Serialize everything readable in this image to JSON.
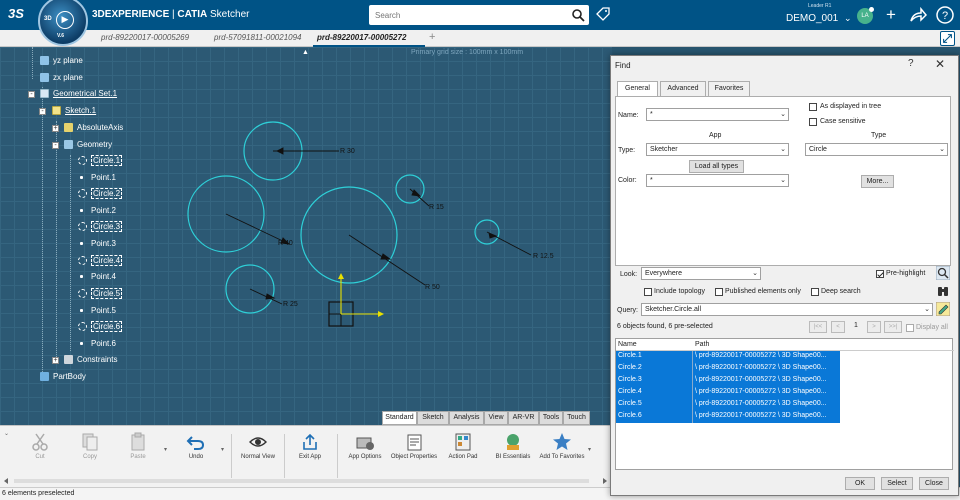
{
  "topbar": {
    "brand": "3DEXPERIENCE",
    "separator": " | ",
    "app": "CATIA",
    "app_suffix": " Sketcher",
    "compass_3d": "3D",
    "compass_version": "V.6",
    "search_placeholder": "Search",
    "user_role": "Leader R1",
    "user_name": "DEMO_001",
    "avatar_initials": "LA",
    "colors": {
      "bar": "#005386",
      "compass": "#1e5f91"
    }
  },
  "doc_tabs": [
    {
      "label": "prd-89220017-00005269",
      "active": false
    },
    {
      "label": "prd-57091811-00021094",
      "active": false
    },
    {
      "label": "prd-89220017-00005272",
      "active": true
    }
  ],
  "tree": [
    {
      "label": "yz plane",
      "icon": "plane-icon",
      "style": "plain"
    },
    {
      "label": "zx plane",
      "icon": "plane-icon",
      "style": "plain"
    },
    {
      "label": "Geometrical Set.1",
      "icon": "geometrical-set-icon",
      "style": "underline"
    },
    {
      "label": "Sketch.1",
      "icon": "sketch-icon",
      "style": "underline"
    },
    {
      "label": "AbsoluteAxis",
      "icon": "axis-icon",
      "style": "plain"
    },
    {
      "label": "Geometry",
      "icon": "geometry-icon",
      "style": "plain"
    },
    {
      "label": "Circle.1",
      "icon": "circle-icon",
      "style": "highlight"
    },
    {
      "label": "Point.1",
      "icon": "point-icon",
      "style": "plain"
    },
    {
      "label": "Circle.2",
      "icon": "circle-icon",
      "style": "highlight"
    },
    {
      "label": "Point.2",
      "icon": "point-icon",
      "style": "plain"
    },
    {
      "label": "Circle.3",
      "icon": "circle-icon",
      "style": "highlight"
    },
    {
      "label": "Point.3",
      "icon": "point-icon",
      "style": "plain"
    },
    {
      "label": "Circle.4",
      "icon": "circle-icon",
      "style": "highlight"
    },
    {
      "label": "Point.4",
      "icon": "point-icon",
      "style": "plain"
    },
    {
      "label": "Circle.5",
      "icon": "circle-icon",
      "style": "highlight"
    },
    {
      "label": "Point.5",
      "icon": "point-icon",
      "style": "plain"
    },
    {
      "label": "Circle.6",
      "icon": "circle-icon",
      "style": "highlight"
    },
    {
      "label": "Point.6",
      "icon": "point-icon",
      "style": "plain"
    },
    {
      "label": "Constraints",
      "icon": "constraints-icon",
      "style": "plain"
    },
    {
      "label": "PartBody",
      "icon": "partbody-icon",
      "style": "plain"
    }
  ],
  "viewport": {
    "grid_label": "Primary grid size : 100mm x 100mm",
    "dimensions": [
      "R 30",
      "R 40",
      "R 15",
      "R 50",
      "R 12.5",
      "R 25"
    ],
    "circle_color": "#2ed0d8",
    "axis_color": "#e8e000"
  },
  "ws_tabs": [
    "Standard",
    "Sketch",
    "Analysis",
    "View",
    "AR-VR",
    "Tools",
    "Touch"
  ],
  "actions": [
    {
      "label": "Cut",
      "icon": "scissors-icon",
      "enabled": false
    },
    {
      "label": "Copy",
      "icon": "copy-icon",
      "enabled": false
    },
    {
      "label": "Paste",
      "icon": "paste-icon",
      "enabled": false
    },
    {
      "label": "Undo",
      "icon": "undo-icon",
      "enabled": true
    },
    {
      "label": "Normal View",
      "icon": "normal-view-icon",
      "enabled": true
    },
    {
      "label": "Exit App",
      "icon": "exit-app-icon",
      "enabled": true
    },
    {
      "label": "App Options",
      "icon": "app-options-icon",
      "enabled": true
    },
    {
      "label": "Object Properties",
      "icon": "object-properties-icon",
      "enabled": true
    },
    {
      "label": "Action Pad",
      "icon": "action-pad-icon",
      "enabled": true
    },
    {
      "label": "BI Essentials",
      "icon": "bi-essentials-icon",
      "enabled": true
    },
    {
      "label": "Add To Favorites",
      "icon": "star-icon",
      "enabled": true
    }
  ],
  "status": "6 elements preselected",
  "find": {
    "title": "Find",
    "help": "?",
    "tabs": [
      "General",
      "Advanced",
      "Favorites"
    ],
    "name_label": "Name:",
    "name_value": "*",
    "as_displayed": "As displayed in tree",
    "case_sensitive": "Case sensitive",
    "app_label": "App",
    "type_header": "Type",
    "type_label": "Type:",
    "app_value": "Sketcher",
    "type_value": "Circle",
    "load_all": "Load all types",
    "color_label": "Color:",
    "color_value": "*",
    "more": "More...",
    "look_label": "Look:",
    "look_value": "Everywhere",
    "pre_highlight": "Pre-highlight",
    "include_topology": "Include topology",
    "published_only": "Published elements only",
    "deep_search": "Deep search",
    "query_label": "Query:",
    "query_value": "Sketcher.Circle.all",
    "result_text": "6 objects found, 6 pre-selected",
    "page": "1",
    "display_all": "Display all",
    "col_name": "Name",
    "col_path": "Path",
    "results": [
      {
        "name": "Circle.1",
        "path": "\\ prd-89220017-00005272 \\ 3D Shape00..."
      },
      {
        "name": "Circle.2",
        "path": "\\ prd-89220017-00005272 \\ 3D Shape00..."
      },
      {
        "name": "Circle.3",
        "path": "\\ prd-89220017-00005272 \\ 3D Shape00..."
      },
      {
        "name": "Circle.4",
        "path": "\\ prd-89220017-00005272 \\ 3D Shape00..."
      },
      {
        "name": "Circle.5",
        "path": "\\ prd-89220017-00005272 \\ 3D Shape00..."
      },
      {
        "name": "Circle.6",
        "path": "\\ prd-89220017-00005272 \\ 3D Shape00..."
      }
    ],
    "ok": "OK",
    "select": "Select",
    "close": "Close",
    "selection_color": "#0a78d7"
  }
}
